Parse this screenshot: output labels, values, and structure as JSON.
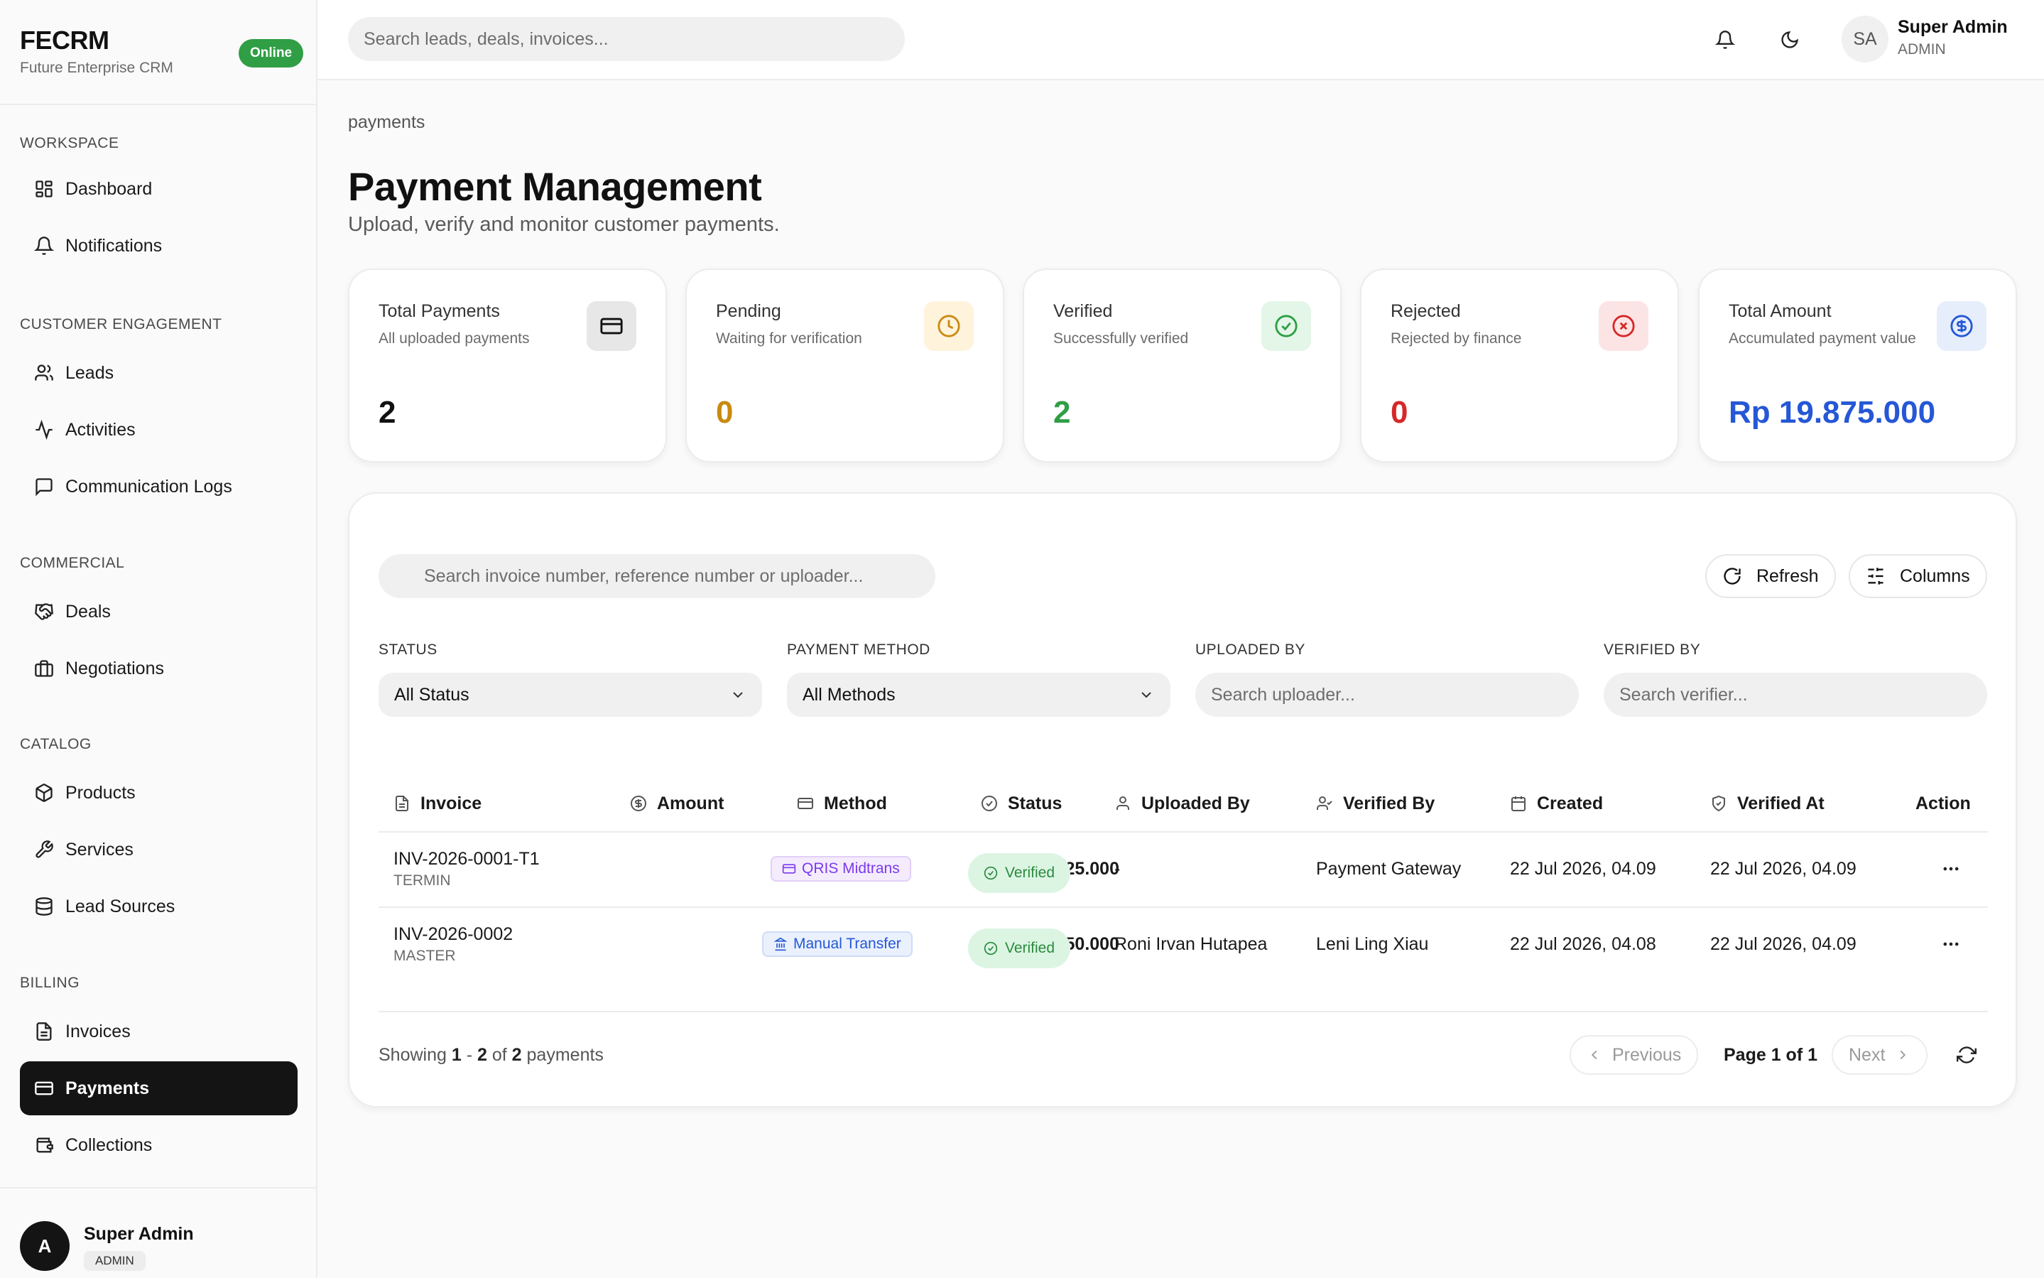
{
  "brand": {
    "name": "FECRM",
    "subtitle": "Future Enterprise CRM",
    "status": "Online"
  },
  "sidebar": {
    "groups": [
      {
        "title": "WORKSPACE",
        "items": [
          {
            "label": "Dashboard",
            "icon": "dashboard-icon"
          },
          {
            "label": "Notifications",
            "icon": "bell-icon"
          }
        ]
      },
      {
        "title": "CUSTOMER ENGAGEMENT",
        "items": [
          {
            "label": "Leads",
            "icon": "users-icon"
          },
          {
            "label": "Activities",
            "icon": "activity-icon"
          },
          {
            "label": "Communication Logs",
            "icon": "message-icon"
          }
        ]
      },
      {
        "title": "COMMERCIAL",
        "items": [
          {
            "label": "Deals",
            "icon": "handshake-icon"
          },
          {
            "label": "Negotiations",
            "icon": "briefcase-icon"
          }
        ]
      },
      {
        "title": "CATALOG",
        "items": [
          {
            "label": "Products",
            "icon": "package-icon"
          },
          {
            "label": "Services",
            "icon": "wrench-icon"
          },
          {
            "label": "Lead Sources",
            "icon": "database-icon"
          }
        ]
      },
      {
        "title": "BILLING",
        "items": [
          {
            "label": "Invoices",
            "icon": "file-text-icon"
          },
          {
            "label": "Payments",
            "icon": "credit-card-icon",
            "active": true
          },
          {
            "label": "Collections",
            "icon": "wallet-icon"
          }
        ]
      }
    ],
    "user": {
      "initial": "A",
      "name": "Super Admin",
      "role": "ADMIN"
    }
  },
  "topbar": {
    "search_placeholder": "Search leads, deals, invoices...",
    "user": {
      "initials": "SA",
      "name": "Super Admin",
      "role": "ADMIN"
    }
  },
  "page": {
    "breadcrumb": "payments",
    "title": "Payment Management",
    "subtitle": "Upload, verify and monitor customer payments."
  },
  "stats": [
    {
      "label": "Total Payments",
      "sub": "All uploaded payments",
      "value": "2",
      "color": "#111111",
      "icon": "credit-card-icon"
    },
    {
      "label": "Pending",
      "sub": "Waiting for verification",
      "value": "0",
      "color": "#c98a12",
      "icon": "clock-icon"
    },
    {
      "label": "Verified",
      "sub": "Successfully verified",
      "value": "2",
      "color": "#2f9e44",
      "icon": "check-circle-icon"
    },
    {
      "label": "Rejected",
      "sub": "Rejected by finance",
      "value": "0",
      "color": "#d62828",
      "icon": "x-circle-icon"
    },
    {
      "label": "Total Amount",
      "sub": "Accumulated payment value",
      "value": "Rp 19.875.000",
      "color": "#2557d6",
      "icon": "dollar-circle-icon"
    }
  ],
  "table_tools": {
    "search_placeholder": "Search invoice number, reference number or uploader...",
    "refresh_label": "Refresh",
    "columns_label": "Columns"
  },
  "filters": {
    "status_label": "STATUS",
    "status_value": "All Status",
    "method_label": "PAYMENT METHOD",
    "method_value": "All Methods",
    "uploaded_label": "UPLOADED BY",
    "uploaded_placeholder": "Search uploader...",
    "verified_label": "VERIFIED BY",
    "verified_placeholder": "Search verifier..."
  },
  "table": {
    "columns": [
      "Invoice",
      "Amount",
      "Method",
      "Status",
      "Uploaded By",
      "Verified By",
      "Created",
      "Verified At",
      "Action"
    ],
    "rows": [
      {
        "invoice": "INV-2026-0001-T1",
        "type": "TERMIN",
        "amount": "Rp 3.125.000",
        "method": "QRIS Midtrans",
        "status": "Verified",
        "uploaded_by": "-",
        "verified_by": "Payment Gateway",
        "created": "22 Jul 2026, 04.09",
        "verified_at": "22 Jul 2026, 04.09"
      },
      {
        "invoice": "INV-2026-0002",
        "type": "MASTER",
        "amount": "Rp 16.750.000",
        "method": "Manual Transfer",
        "status": "Verified",
        "uploaded_by": "Roni Irvan Hutapea",
        "verified_by": "Leni Ling Xiau",
        "created": "22 Jul 2026, 04.08",
        "verified_at": "22 Jul 2026, 04.09"
      }
    ]
  },
  "pagination": {
    "showing_prefix": "Showing",
    "range_start": "1",
    "range_sep": "-",
    "range_end": "2",
    "of": "of",
    "total": "2",
    "suffix": "payments",
    "previous": "Previous",
    "page_info": "Page 1 of 1",
    "next": "Next"
  }
}
